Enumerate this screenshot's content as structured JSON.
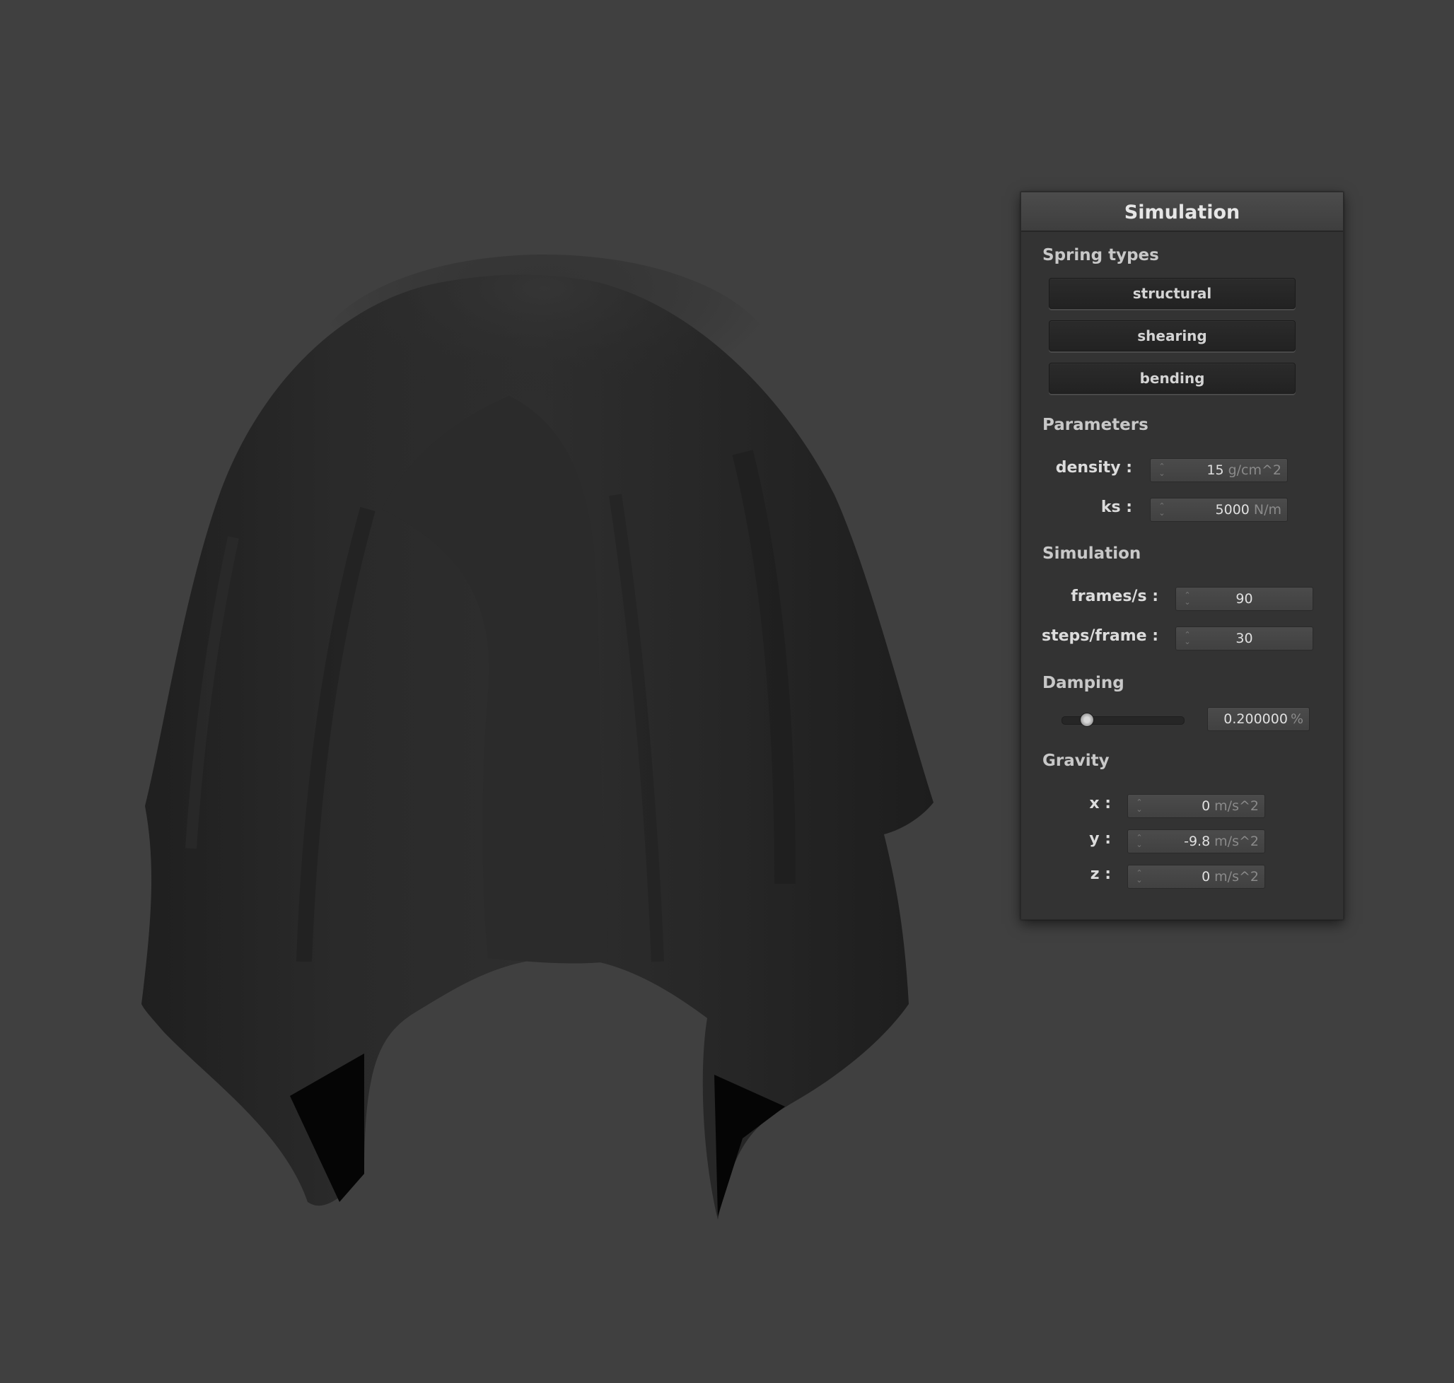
{
  "panel": {
    "title": "Simulation",
    "spring_types": {
      "heading": "Spring types",
      "buttons": [
        "structural",
        "shearing",
        "bending"
      ]
    },
    "parameters": {
      "heading": "Parameters",
      "density": {
        "label": "density :",
        "value": "15",
        "unit": "g/cm^2"
      },
      "ks": {
        "label": "ks :",
        "value": "5000",
        "unit": "N/m"
      }
    },
    "simulation": {
      "heading": "Simulation",
      "fps": {
        "label": "frames/s :",
        "value": "90"
      },
      "steps": {
        "label": "steps/frame :",
        "value": "30"
      }
    },
    "damping": {
      "heading": "Damping",
      "value": "0.200000",
      "unit": "%",
      "slider_fraction": 0.2
    },
    "gravity": {
      "heading": "Gravity",
      "x": {
        "label": "x :",
        "value": "0",
        "unit": "m/s^2"
      },
      "y": {
        "label": "y :",
        "value": "-9.8",
        "unit": "m/s^2"
      },
      "z": {
        "label": "z :",
        "value": "0",
        "unit": "m/s^2"
      }
    }
  },
  "colors": {
    "background": "#404040",
    "cloth": "#262626",
    "panel": "#333333"
  }
}
